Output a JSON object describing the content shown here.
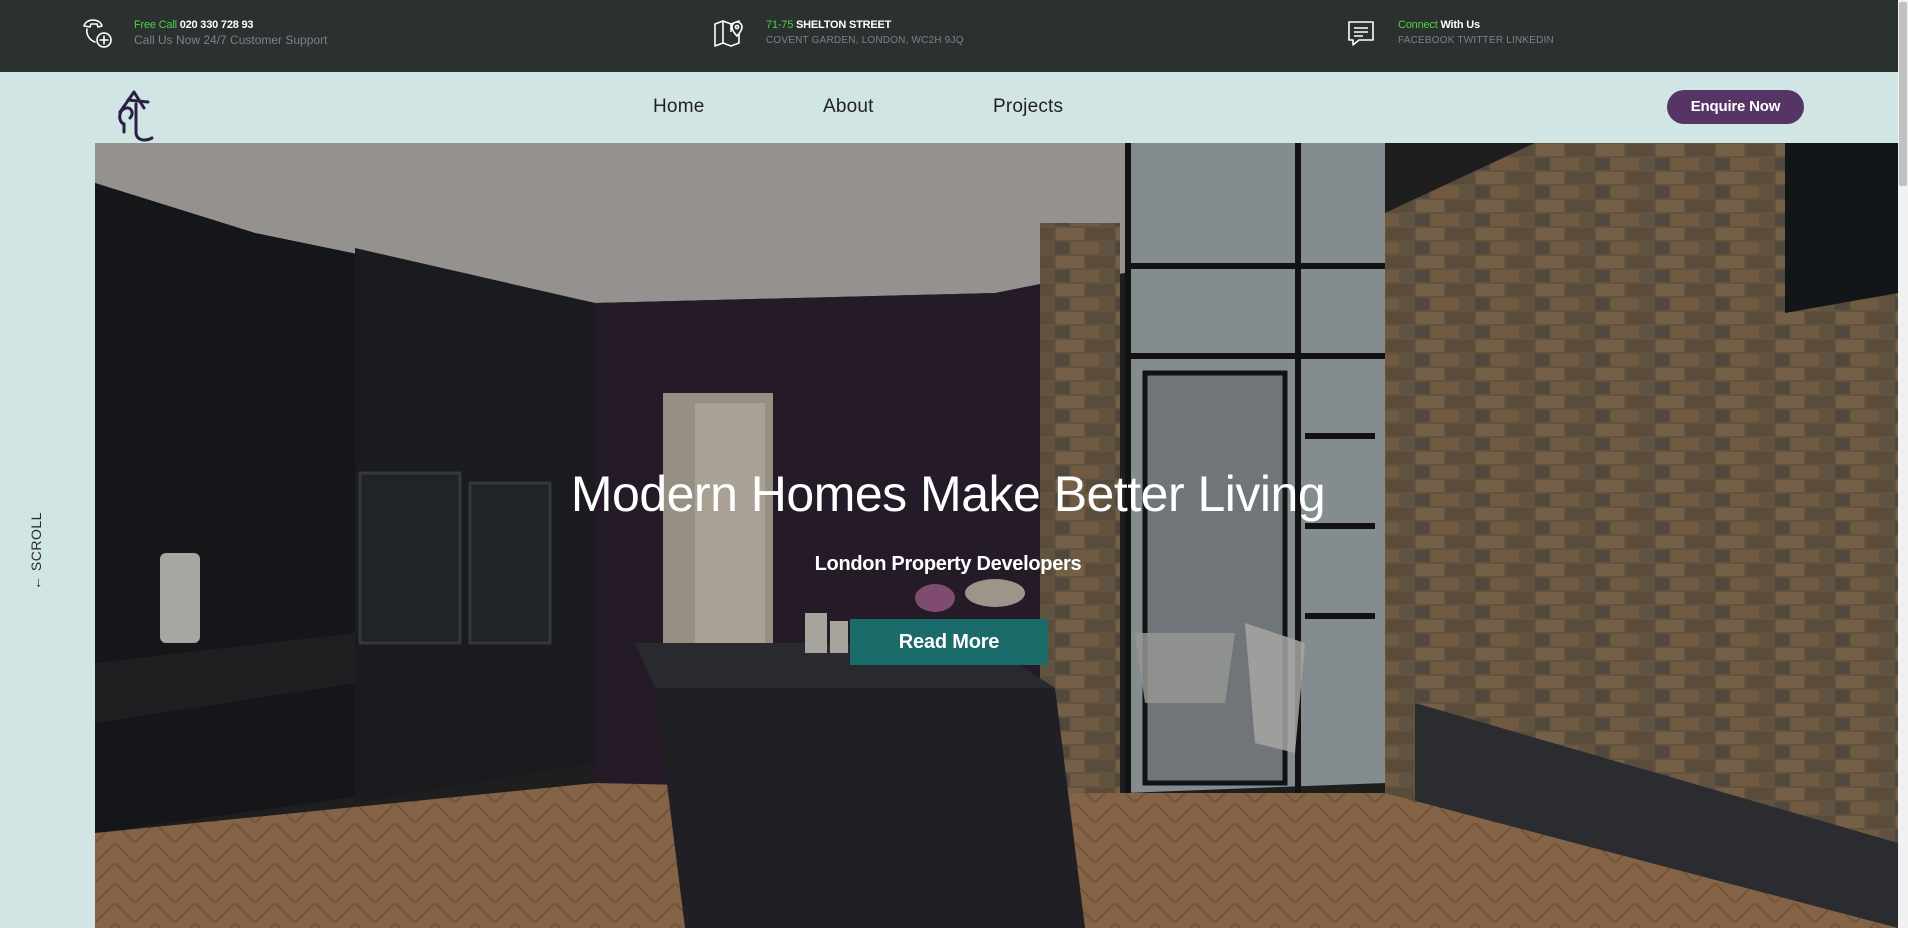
{
  "topbar": {
    "phone": {
      "icon": "phone-add-icon",
      "accent": "Free Call",
      "number": "020 330 728 93",
      "sub": "Call Us Now 24/7 Customer Support"
    },
    "address": {
      "icon": "map-pin-icon",
      "accent": "71-75",
      "street": "SHELTON STREET",
      "sub": "COVENT GARDEN, LONDON, WC2H 9JQ"
    },
    "social": {
      "icon": "chat-icon",
      "accent": "Connect",
      "label": "With Us",
      "sub": "FACEBOOK TWITTER LINKEDIN"
    }
  },
  "nav": {
    "logo_icon": "brand-logo",
    "links": [
      "Home",
      "About",
      "Projects"
    ],
    "cta": "Enquire Now"
  },
  "side": {
    "scroll_label": "← SCROLL"
  },
  "hero": {
    "title": "Modern Homes Make Better Living",
    "subtitle": "London Property Developers",
    "button": "Read More"
  },
  "colors": {
    "topbar_bg": "#2b312f",
    "accent_green": "#49d24c",
    "page_bg": "#d1e6e4",
    "cta_purple": "#563565",
    "hero_button": "#1b6b6b"
  }
}
